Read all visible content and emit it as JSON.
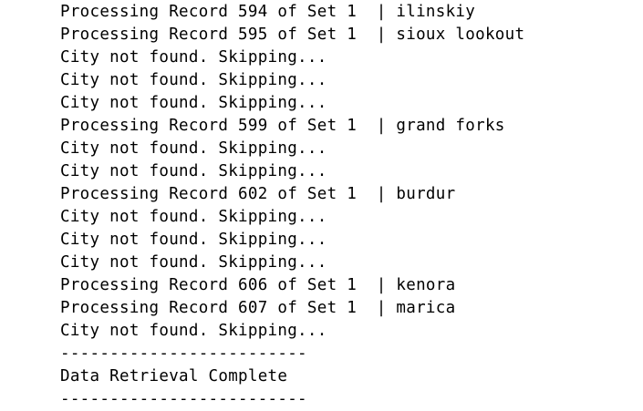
{
  "output": {
    "lines": [
      "Processing Record 594 of Set 1  | ilinskiy",
      "Processing Record 595 of Set 1  | sioux lookout",
      "City not found. Skipping...",
      "City not found. Skipping...",
      "City not found. Skipping...",
      "Processing Record 599 of Set 1  | grand forks",
      "City not found. Skipping...",
      "City not found. Skipping...",
      "Processing Record 602 of Set 1  | burdur",
      "City not found. Skipping...",
      "City not found. Skipping...",
      "City not found. Skipping...",
      "Processing Record 606 of Set 1  | kenora",
      "Processing Record 607 of Set 1  | marica",
      "City not found. Skipping...",
      "-------------------------",
      "Data Retrieval Complete",
      "-------------------------"
    ]
  }
}
